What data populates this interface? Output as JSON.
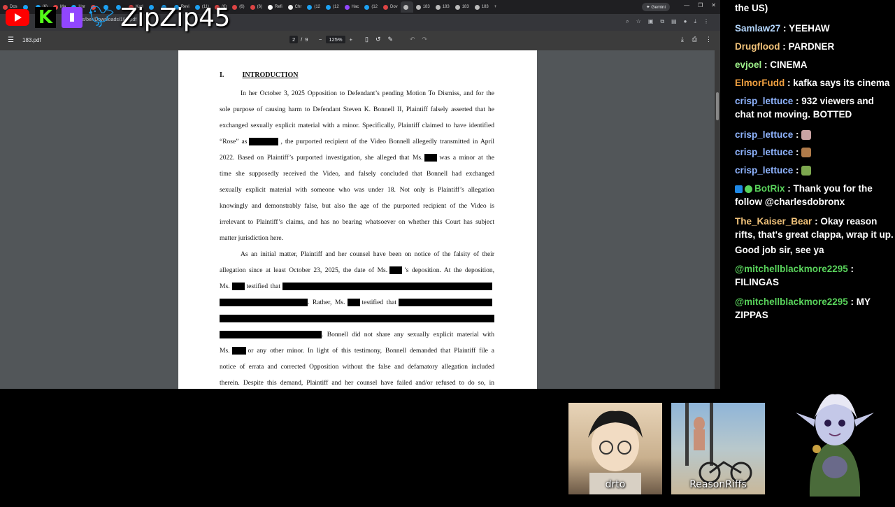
{
  "tabs": [
    "Dos",
    "",
    "(6)",
    "Ma",
    "Unr",
    "",
    "",
    "",
    "Karl",
    "",
    "",
    "Revi",
    "(11)",
    "(6)",
    "(6)",
    "(6)",
    "Refi",
    "Chr",
    "(12",
    "(12",
    "Hac",
    "(12",
    "Dov",
    "",
    "183",
    "183",
    "183",
    "183"
  ],
  "gemini_label": "Gemini",
  "address_url": "C:/Users/ber/Downloads/183.pdf",
  "pdf": {
    "filename": "183.pdf",
    "page_current": "2",
    "page_total": "9",
    "zoom": "125%"
  },
  "document": {
    "heading_number": "I.",
    "heading_title": "INTRODUCTION",
    "lines": [
      [
        "In her October 3, 2025 Opposition to Defendant’s pending Motion To Dismiss, and for the"
      ],
      [
        "sole purpose of causing harm to Defendant Steven K. Bonnell II, Plaintiff falsely asserted that he"
      ],
      [
        "exchanged sexually explicit material with a minor. Specifically, Plaintiff claimed to have identified"
      ],
      [
        "“Rose” as",
        ", the purported recipient of the Video Bonnell allegedly transmitted in April"
      ],
      [
        "2022. Based on Plaintiff’s purported investigation, she alleged that Ms.",
        "was a minor at the"
      ],
      [
        "time she supposedly received the Video, and falsely concluded that Bonnell had exchanged"
      ],
      [
        "sexually explicit material with someone who was under 18. Not only is Plaintiff’s allegation"
      ],
      [
        "knowingly and demonstrably false, but also the age of the purported recipient of the Video is"
      ],
      [
        "irrelevant to Plaintiff’s claims, and has no bearing whatsoever on whether this Court has subject"
      ],
      [
        "matter jurisdiction here."
      ],
      [
        "As an initial matter, Plaintiff and her counsel have been on notice of the falsity of their"
      ],
      [
        "allegation since at least October 23, 2025, the date of Ms.",
        "’s deposition. At the deposition,"
      ],
      [
        "Ms.",
        "testified that"
      ],
      [
        ". Rather, Ms.",
        "testified that"
      ],
      [],
      [
        ". Bonnell did not share any sexually explicit material with"
      ],
      [
        "Ms.",
        "or any other minor. In light of this testimony, Bonnell demanded that Plaintiff file a"
      ],
      [
        "notice of errata and corrected Opposition without the false and defamatory allegation included"
      ],
      [
        "therein. Despite this demand, Plaintiff and her counsel have failed and/or refused to do so, in"
      ]
    ]
  },
  "overlay": {
    "handle": "ZipZip45"
  },
  "chat": [
    {
      "cont": "the US)"
    },
    {
      "user": "Samlaw27",
      "color": "#b5d8ff",
      "text": "YEEHAW"
    },
    {
      "user": "Drugflood",
      "color": "#f2c37a",
      "text": "PARDNER"
    },
    {
      "user": "evjoel",
      "color": "#9ef08a",
      "text": "CINEMA"
    },
    {
      "user": "ElmorFudd",
      "color": "#f0a040",
      "text": "kafka says its cinema"
    },
    {
      "user": "crisp_lettuce",
      "color": "#8fb4ff",
      "text": "932 viewers and",
      "cont": "chat not moving. BOTTED"
    },
    {
      "user": "crisp_lettuce",
      "color": "#8fb4ff",
      "emote": "#c9a3a3"
    },
    {
      "user": "crisp_lettuce",
      "color": "#8fb4ff",
      "emote": "#b07b4a"
    },
    {
      "user": "crisp_lettuce",
      "color": "#8fb4ff",
      "emote": "#7da84f"
    },
    {
      "user": "BotRix",
      "color": "#59d35b",
      "text": "Thank you for the",
      "cont": "follow @charlesdobronx",
      "badges": true
    },
    {
      "user": "The_Kaiser_Bear",
      "color": "#f2c37a",
      "text": "Okay reason",
      "cont": "rifts, that's great clappa, wrap it up.",
      "cont2": "Good job sir, see ya"
    },
    {
      "user": "@mitchellblackmore2295",
      "color": "#59d35b",
      "text": "",
      "cont": "FILINGAS"
    },
    {
      "user": "@mitchellblackmore2295",
      "color": "#59d35b",
      "text": "MY",
      "cont": "ZIPPAS"
    }
  ],
  "cams": [
    {
      "label": "drto"
    },
    {
      "label": "ReasonRiffs"
    }
  ]
}
